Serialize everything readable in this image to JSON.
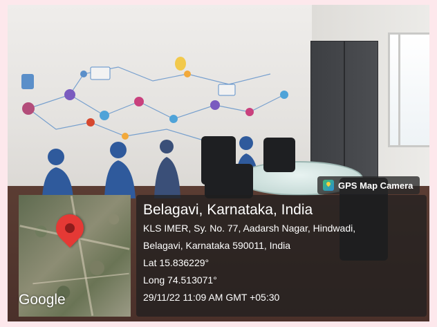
{
  "badge": {
    "label": "GPS Map Camera",
    "icon": "gps-map-camera-icon"
  },
  "location": {
    "title": "Belagavi, Karnataka, India",
    "address_line1": "KLS IMER, Sy. No. 77, Aadarsh Nagar, Hindwadi,",
    "address_line2": "Belagavi, Karnataka 590011, India",
    "lat": "Lat 15.836229°",
    "long": "Long 74.513071°",
    "timestamp": "29/11/22 11:09 AM GMT +05:30"
  },
  "map": {
    "provider": "Google",
    "marker_color": "#e53935"
  }
}
